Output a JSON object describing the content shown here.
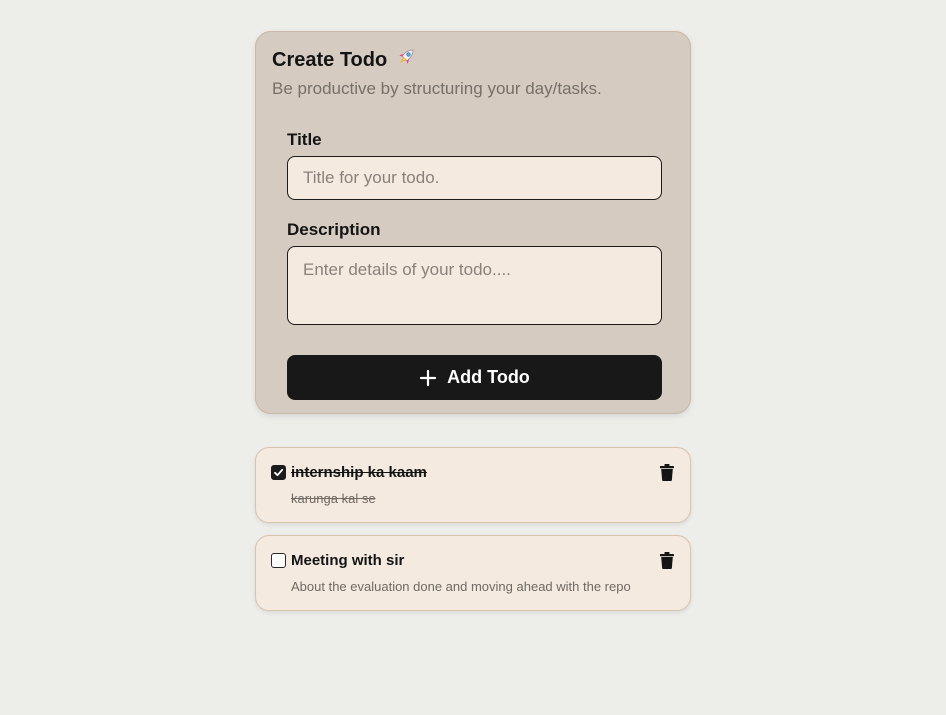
{
  "form": {
    "title": "Create Todo",
    "subtitle": "Be productive by structuring your day/tasks.",
    "title_label": "Title",
    "title_placeholder": "Title for your todo.",
    "title_value": "",
    "description_label": "Description",
    "description_placeholder": "Enter details of your todo....",
    "description_value": "",
    "add_button_label": "Add Todo",
    "add_icon": "plus-icon",
    "title_icon": "rocket-icon"
  },
  "todos": [
    {
      "title": "internship ka kaam",
      "description": "karunga kal se",
      "completed": true
    },
    {
      "title": "Meeting with sir",
      "description": "About the evaluation done and moving ahead with the repo",
      "completed": false
    }
  ],
  "colors": {
    "background": "#ededea",
    "card": "#d5cbc1",
    "input": "#f4eae0",
    "button": "#181818"
  }
}
